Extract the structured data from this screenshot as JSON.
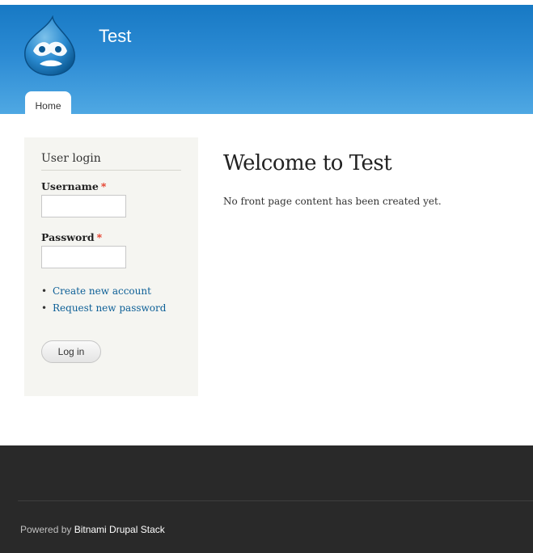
{
  "header": {
    "site_name": "Test",
    "logo_icon": "drupal-drop-logo",
    "accent_color": "#1779c4"
  },
  "nav": {
    "tabs": [
      {
        "label": "Home",
        "active": true
      }
    ]
  },
  "sidebar": {
    "block_title": "User login",
    "username_label": "Username",
    "password_label": "Password",
    "required_marker": "*",
    "username_value": "",
    "password_value": "",
    "links": [
      "Create new account",
      "Request new password"
    ],
    "login_button": "Log in"
  },
  "main": {
    "title": "Welcome to Test",
    "body": "No front page content has been created yet."
  },
  "footer": {
    "prefix": "Powered by ",
    "link": "Bitnami Drupal Stack"
  }
}
